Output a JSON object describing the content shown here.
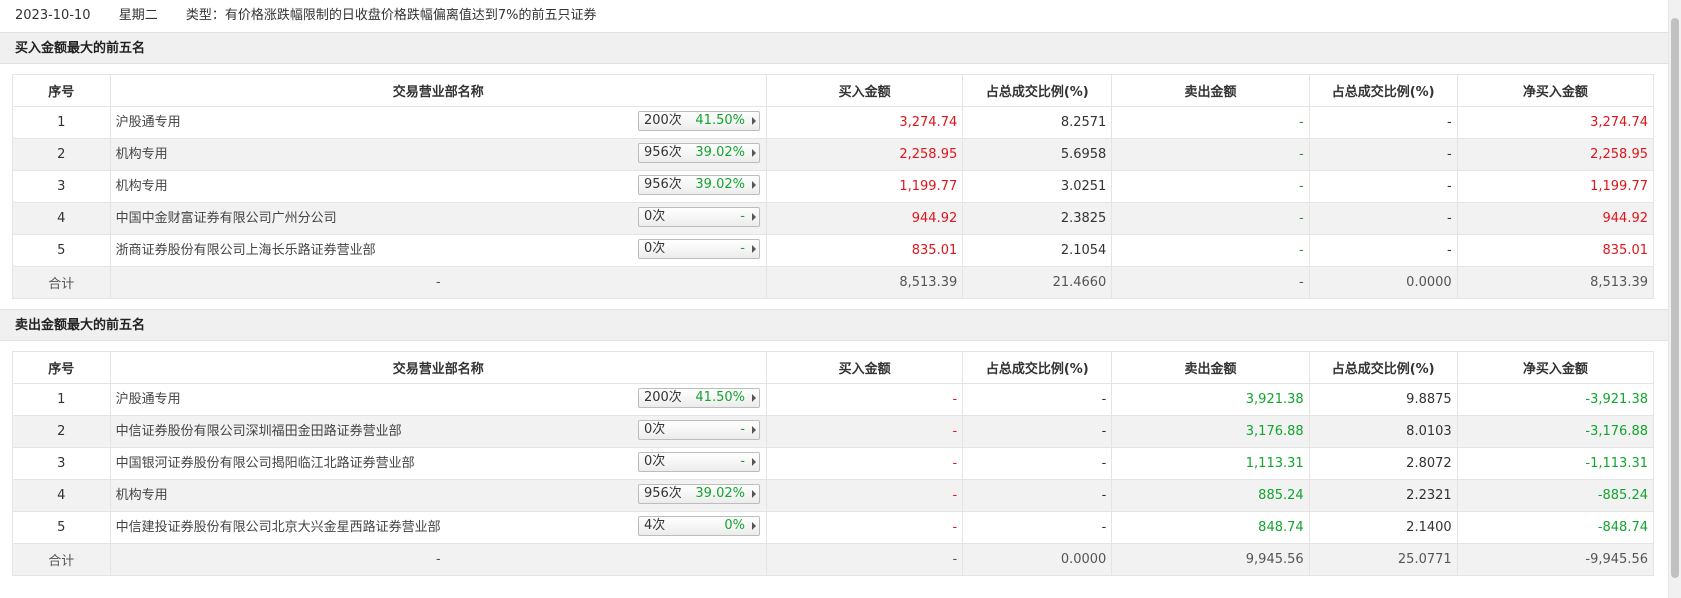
{
  "header": {
    "date": "2023-10-10",
    "weekday": "星期二",
    "type_text": "类型：有价格涨跌幅限制的日收盘价格跌幅偏离值达到7%的前五只证券"
  },
  "columns": [
    "序号",
    "交易营业部名称",
    "买入金额",
    "占总成交比例(%)",
    "卖出金额",
    "占总成交比例(%)",
    "净买入金额"
  ],
  "buy_section": {
    "title": "买入金额最大的前五名",
    "rows": [
      {
        "idx": "1",
        "name": "沪股通专用",
        "count": "200次",
        "pct": "41.50%",
        "buy": "3,274.74",
        "buy_ratio": "8.2571",
        "sell": "-",
        "sell_ratio": "-",
        "net": "3,274.74"
      },
      {
        "idx": "2",
        "name": "机构专用",
        "count": "956次",
        "pct": "39.02%",
        "buy": "2,258.95",
        "buy_ratio": "5.6958",
        "sell": "-",
        "sell_ratio": "-",
        "net": "2,258.95"
      },
      {
        "idx": "3",
        "name": "机构专用",
        "count": "956次",
        "pct": "39.02%",
        "buy": "1,199.77",
        "buy_ratio": "3.0251",
        "sell": "-",
        "sell_ratio": "-",
        "net": "1,199.77"
      },
      {
        "idx": "4",
        "name": "中国中金财富证券有限公司广州分公司",
        "count": "0次",
        "pct": "-",
        "buy": "944.92",
        "buy_ratio": "2.3825",
        "sell": "-",
        "sell_ratio": "-",
        "net": "944.92"
      },
      {
        "idx": "5",
        "name": "浙商证券股份有限公司上海长乐路证券营业部",
        "count": "0次",
        "pct": "-",
        "buy": "835.01",
        "buy_ratio": "2.1054",
        "sell": "-",
        "sell_ratio": "-",
        "net": "835.01"
      }
    ],
    "total": {
      "label": "合计",
      "name": "-",
      "buy": "8,513.39",
      "buy_ratio": "21.4660",
      "sell": "-",
      "sell_ratio": "0.0000",
      "net": "8,513.39"
    }
  },
  "sell_section": {
    "title": "卖出金额最大的前五名",
    "rows": [
      {
        "idx": "1",
        "name": "沪股通专用",
        "count": "200次",
        "pct": "41.50%",
        "buy": "-",
        "buy_ratio": "-",
        "sell": "3,921.38",
        "sell_ratio": "9.8875",
        "net": "-3,921.38"
      },
      {
        "idx": "2",
        "name": "中信证券股份有限公司深圳福田金田路证券营业部",
        "count": "0次",
        "pct": "-",
        "buy": "-",
        "buy_ratio": "-",
        "sell": "3,176.88",
        "sell_ratio": "8.0103",
        "net": "-3,176.88"
      },
      {
        "idx": "3",
        "name": "中国银河证券股份有限公司揭阳临江北路证券营业部",
        "count": "0次",
        "pct": "-",
        "buy": "-",
        "buy_ratio": "-",
        "sell": "1,113.31",
        "sell_ratio": "2.8072",
        "net": "-1,113.31"
      },
      {
        "idx": "4",
        "name": "机构专用",
        "count": "956次",
        "pct": "39.02%",
        "buy": "-",
        "buy_ratio": "-",
        "sell": "885.24",
        "sell_ratio": "2.2321",
        "net": "-885.24"
      },
      {
        "idx": "5",
        "name": "中信建投证券股份有限公司北京大兴金星西路证券营业部",
        "count": "4次",
        "pct": "0%",
        "buy": "-",
        "buy_ratio": "-",
        "sell": "848.74",
        "sell_ratio": "2.1400",
        "net": "-848.74"
      }
    ],
    "total": {
      "label": "合计",
      "name": "-",
      "buy": "-",
      "buy_ratio": "0.0000",
      "sell": "9,945.56",
      "sell_ratio": "25.0771",
      "net": "-9,945.56"
    }
  },
  "colors": {
    "up": "#e1151b",
    "down": "#11a52e",
    "stripe": "#f2f2f2",
    "title_bg": "#f0f0f0"
  }
}
